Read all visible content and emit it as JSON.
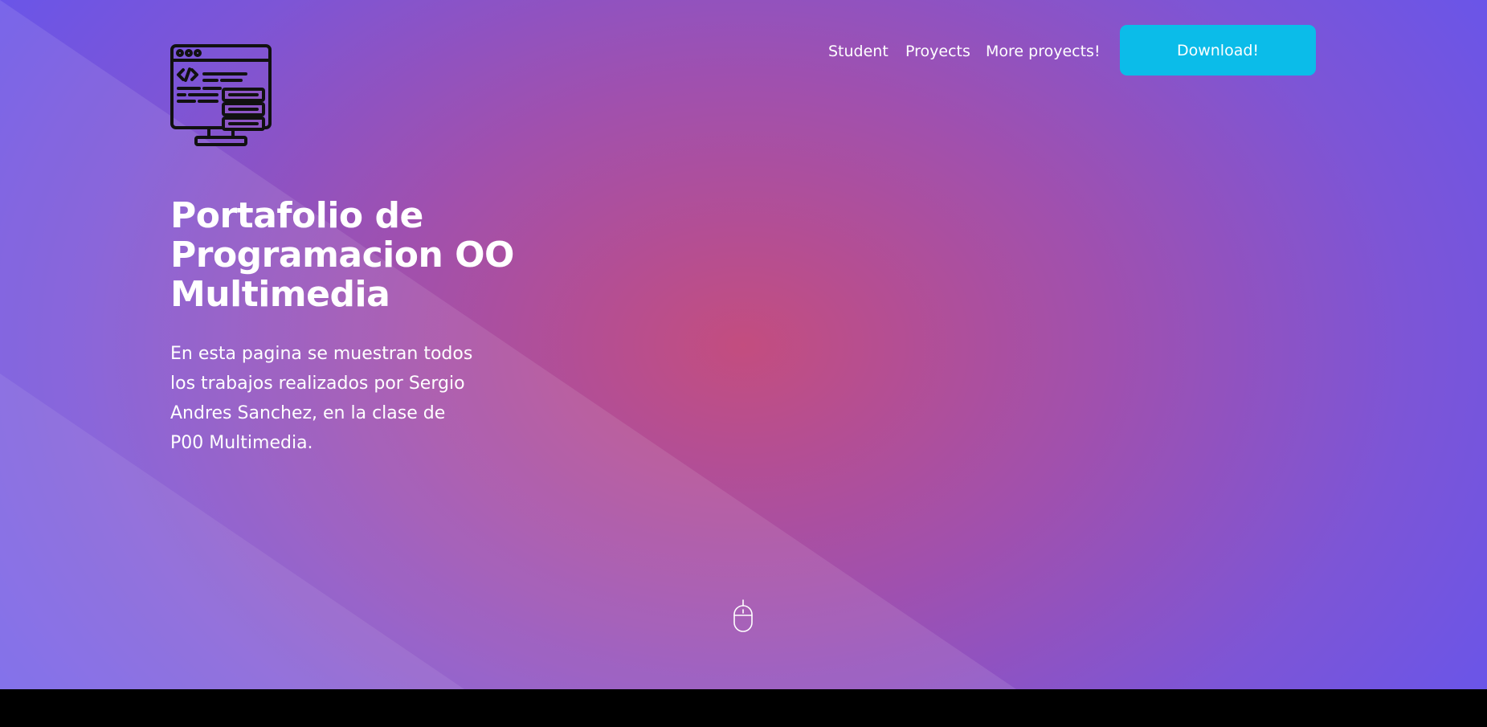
{
  "nav": {
    "items": [
      {
        "label": "Student"
      },
      {
        "label": "Proyects"
      },
      {
        "label": "More proyects!"
      }
    ],
    "download_label": "Download!"
  },
  "hero": {
    "title": "Portafolio de Programacion OO Multimedia",
    "description": "En esta pagina se muestran todos los trabajos realizados por Sergio Andres Sanchez, en la clase de P00 Multimedia."
  },
  "icons": {
    "logo": "monitor-code-server-icon",
    "scroll": "mouse-scroll-icon"
  },
  "colors": {
    "accent": "#0bbce9",
    "gradient_center": "#c34d7f",
    "gradient_edge": "#6a55e8",
    "text": "#ffffff"
  }
}
